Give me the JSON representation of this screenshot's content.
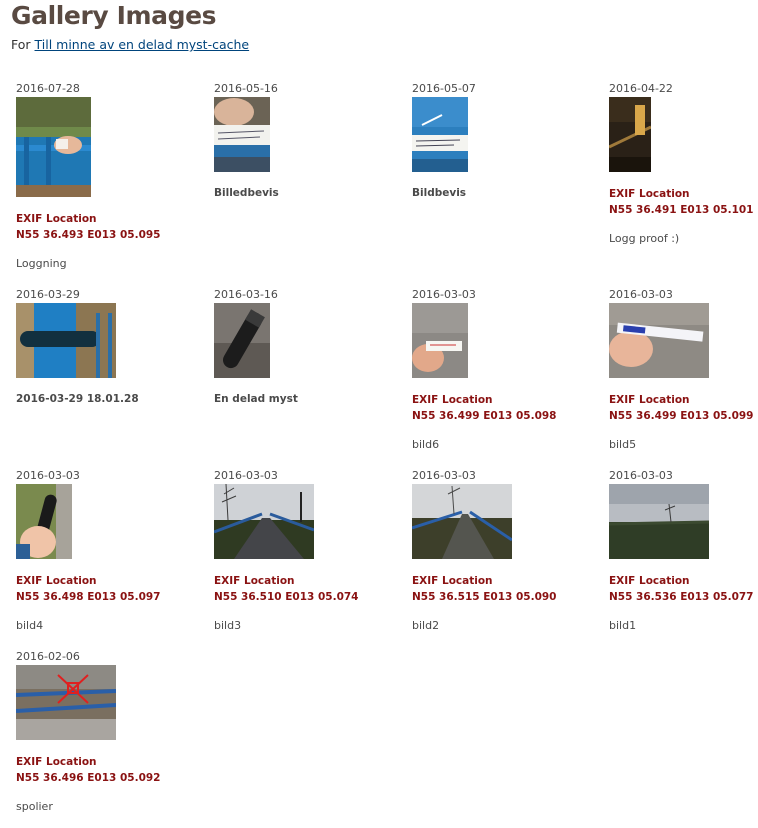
{
  "header": {
    "title": "Gallery Images",
    "for_prefix": "For",
    "cache_link": "Till minne av en delad myst-cache"
  },
  "gallery": [
    {
      "date": "2016-07-28",
      "caption": "",
      "exif_label": "EXIF Location",
      "coords": "N55 36.493 E013 05.095",
      "note": "Loggning",
      "thumb_icon": "photo-hand-on-blue-railing"
    },
    {
      "date": "2016-05-16",
      "caption": "Billedbevis",
      "exif_label": "",
      "coords": "",
      "note": "",
      "thumb_icon": "photo-log-strip"
    },
    {
      "date": "2016-05-07",
      "caption": "Bildbevis",
      "exif_label": "",
      "coords": "",
      "note": "",
      "thumb_icon": "photo-log-strip-on-blue"
    },
    {
      "date": "2016-04-22",
      "caption": "",
      "exif_label": "EXIF Location",
      "coords": "N55 36.491 E013 05.101",
      "note": "Logg proof :)",
      "thumb_icon": "photo-dark-night"
    },
    {
      "date": "2016-03-29",
      "caption": "2016-03-29 18.01.28",
      "exif_label": "",
      "coords": "",
      "note": "",
      "thumb_icon": "photo-tube-on-blue-post"
    },
    {
      "date": "2016-03-16",
      "caption": "En delad myst",
      "exif_label": "",
      "coords": "",
      "note": "",
      "thumb_icon": "photo-black-tube"
    },
    {
      "date": "2016-03-03",
      "caption": "",
      "exif_label": "EXIF Location",
      "coords": "N55 36.499 E013 05.098",
      "note": "bild6",
      "thumb_icon": "photo-hand-with-paper"
    },
    {
      "date": "2016-03-03",
      "caption": "",
      "exif_label": "EXIF Location",
      "coords": "N55 36.499 E013 05.099",
      "note": "bild5",
      "thumb_icon": "photo-hand-with-strip"
    },
    {
      "date": "2016-03-03",
      "caption": "",
      "exif_label": "EXIF Location",
      "coords": "N55 36.498 E013 05.097",
      "note": "bild4",
      "thumb_icon": "photo-hand-holding-tube"
    },
    {
      "date": "2016-03-03",
      "caption": "",
      "exif_label": "EXIF Location",
      "coords": "N55 36.510 E013 05.074",
      "note": "bild3",
      "thumb_icon": "photo-bridge-path"
    },
    {
      "date": "2016-03-03",
      "caption": "",
      "exif_label": "EXIF Location",
      "coords": "N55 36.515 E013 05.090",
      "note": "bild2",
      "thumb_icon": "photo-bridge-path-2"
    },
    {
      "date": "2016-03-03",
      "caption": "",
      "exif_label": "EXIF Location",
      "coords": "N55 36.536 E013 05.077",
      "note": "bild1",
      "thumb_icon": "photo-field-landscape"
    },
    {
      "date": "2016-02-06",
      "caption": "",
      "exif_label": "EXIF Location",
      "coords": "N55 36.496 E013 05.092",
      "note": "spolier",
      "thumb_icon": "photo-railing-spoiler"
    }
  ]
}
